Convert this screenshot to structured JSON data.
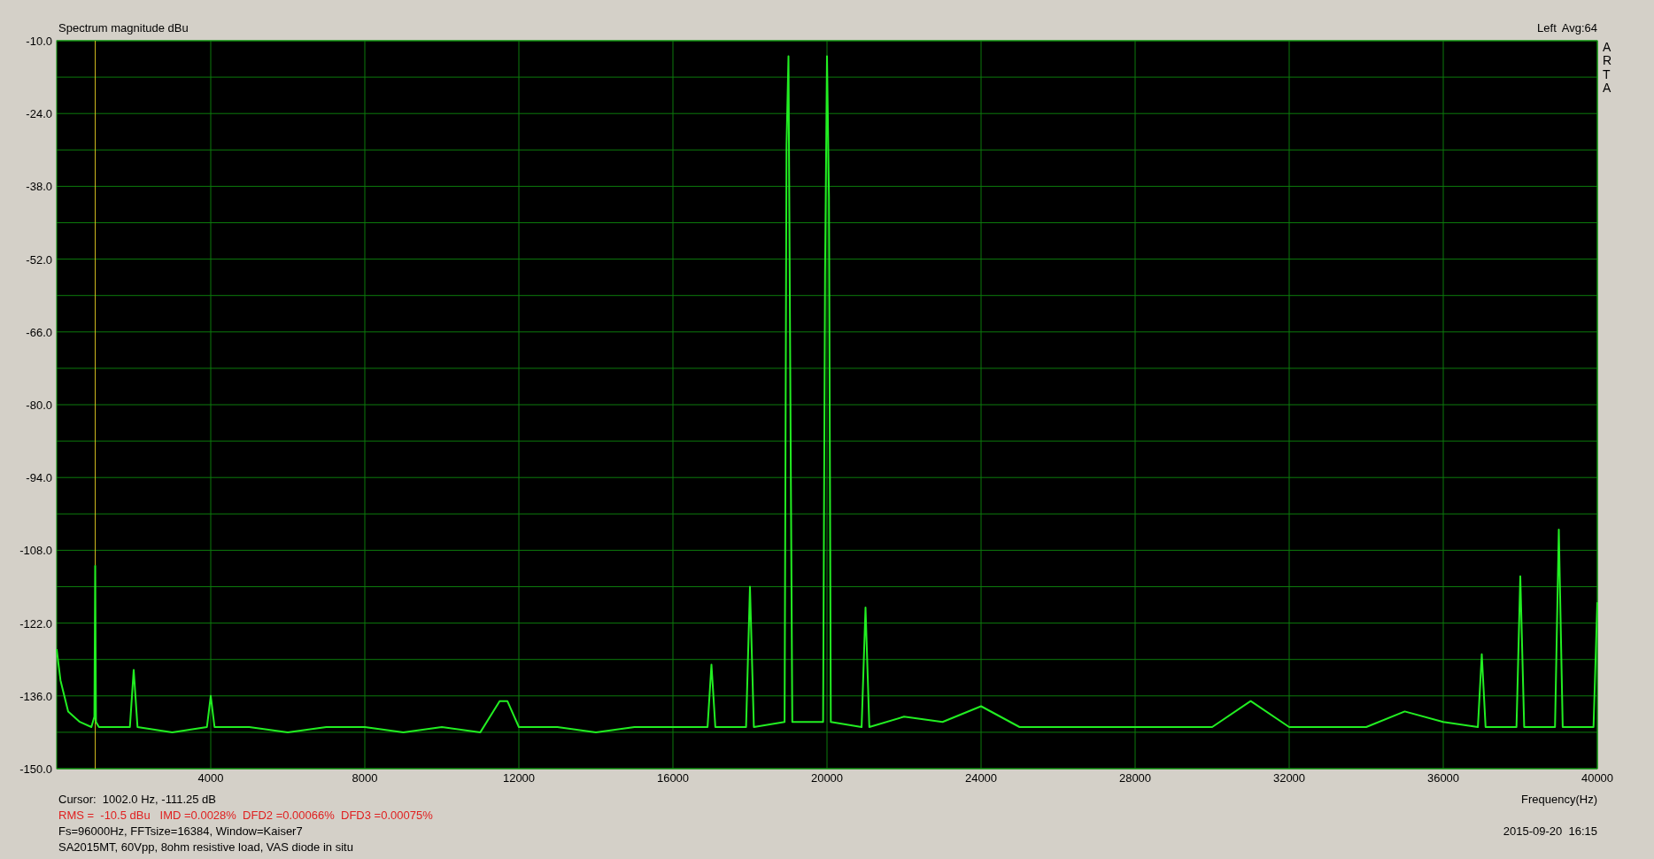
{
  "chart": {
    "averaging": "Avg:64",
    "side_label": "ARTA",
    "chart_data": {
      "type": "line",
      "grid": true,
      "xlabel": "Frequency(Hz)",
      "ylabel": "Spectrum magnitude dBu",
      "xlim": [
        0,
        40000
      ],
      "ylim": [
        -150,
        -10
      ],
      "xticks": [
        4000,
        8000,
        12000,
        16000,
        20000,
        24000,
        28000,
        32000,
        36000,
        40000
      ],
      "yticks": [
        {
          "value": -10,
          "label": "-10.0"
        },
        {
          "value": -24,
          "label": "-24.0"
        },
        {
          "value": -38,
          "label": "-38.0"
        },
        {
          "value": -52,
          "label": "-52.0"
        },
        {
          "value": -66,
          "label": "-66.0"
        },
        {
          "value": -80,
          "label": "-80.0"
        },
        {
          "value": -94,
          "label": "-94.0"
        },
        {
          "value": -108,
          "label": "-108.0"
        },
        {
          "value": -122,
          "label": "-122.0"
        },
        {
          "value": -136,
          "label": "-136.0"
        },
        {
          "value": -150,
          "label": "-150.0"
        }
      ],
      "x": [
        0,
        100,
        300,
        600,
        900,
        980,
        1000,
        1020,
        1100,
        1900,
        2000,
        2100,
        3000,
        3900,
        4000,
        4100,
        5000,
        6000,
        7000,
        8000,
        9000,
        10000,
        11000,
        11500,
        11700,
        12000,
        13000,
        14000,
        15000,
        16000,
        16900,
        17000,
        17100,
        17900,
        18000,
        18100,
        18900,
        18950,
        19000,
        19050,
        19100,
        19900,
        19950,
        20000,
        20050,
        20100,
        20900,
        21000,
        21100,
        22000,
        23000,
        24000,
        25000,
        26000,
        27000,
        28000,
        29000,
        30000,
        31000,
        32000,
        33000,
        34000,
        35000,
        36000,
        36900,
        37000,
        37100,
        37900,
        38000,
        38100,
        38900,
        39000,
        39100,
        39900,
        40000
      ],
      "series": [
        {
          "name": "Left",
          "color": "#22ee22",
          "values": [
            -127,
            -133,
            -139,
            -141,
            -142,
            -140,
            -111,
            -141,
            -142,
            -142,
            -131,
            -142,
            -143,
            -142,
            -136,
            -142,
            -142,
            -143,
            -142,
            -142,
            -143,
            -142,
            -143,
            -137,
            -137,
            -142,
            -142,
            -143,
            -142,
            -142,
            -142,
            -130,
            -142,
            -142,
            -115,
            -142,
            -141,
            -30,
            -13,
            -80,
            -141,
            -141,
            -55,
            -13,
            -40,
            -141,
            -142,
            -119,
            -142,
            -140,
            -141,
            -138,
            -142,
            -142,
            -142,
            -142,
            -142,
            -142,
            -137,
            -142,
            -142,
            -142,
            -139,
            -141,
            -142,
            -128,
            -142,
            -142,
            -113,
            -142,
            -142,
            -104,
            -142,
            -142,
            -118
          ]
        }
      ],
      "ref_lines": [
        {
          "axis": "x",
          "value": 1002
        }
      ]
    }
  },
  "footer": {
    "cursor": "Cursor:  1002.0 Hz, -111.25 dB",
    "measurements": "RMS =  -10.5 dBu   IMD =0.0028%  DFD2 =0.00066%  DFD3 =0.00075%",
    "settings": "Fs=96000Hz, FFTsize=16384, Window=Kaiser7",
    "timestamp": "2015-09-20  16:15",
    "note": "SA2015MT, 60Vpp, 8ohm resistive load, VAS diode in situ"
  }
}
